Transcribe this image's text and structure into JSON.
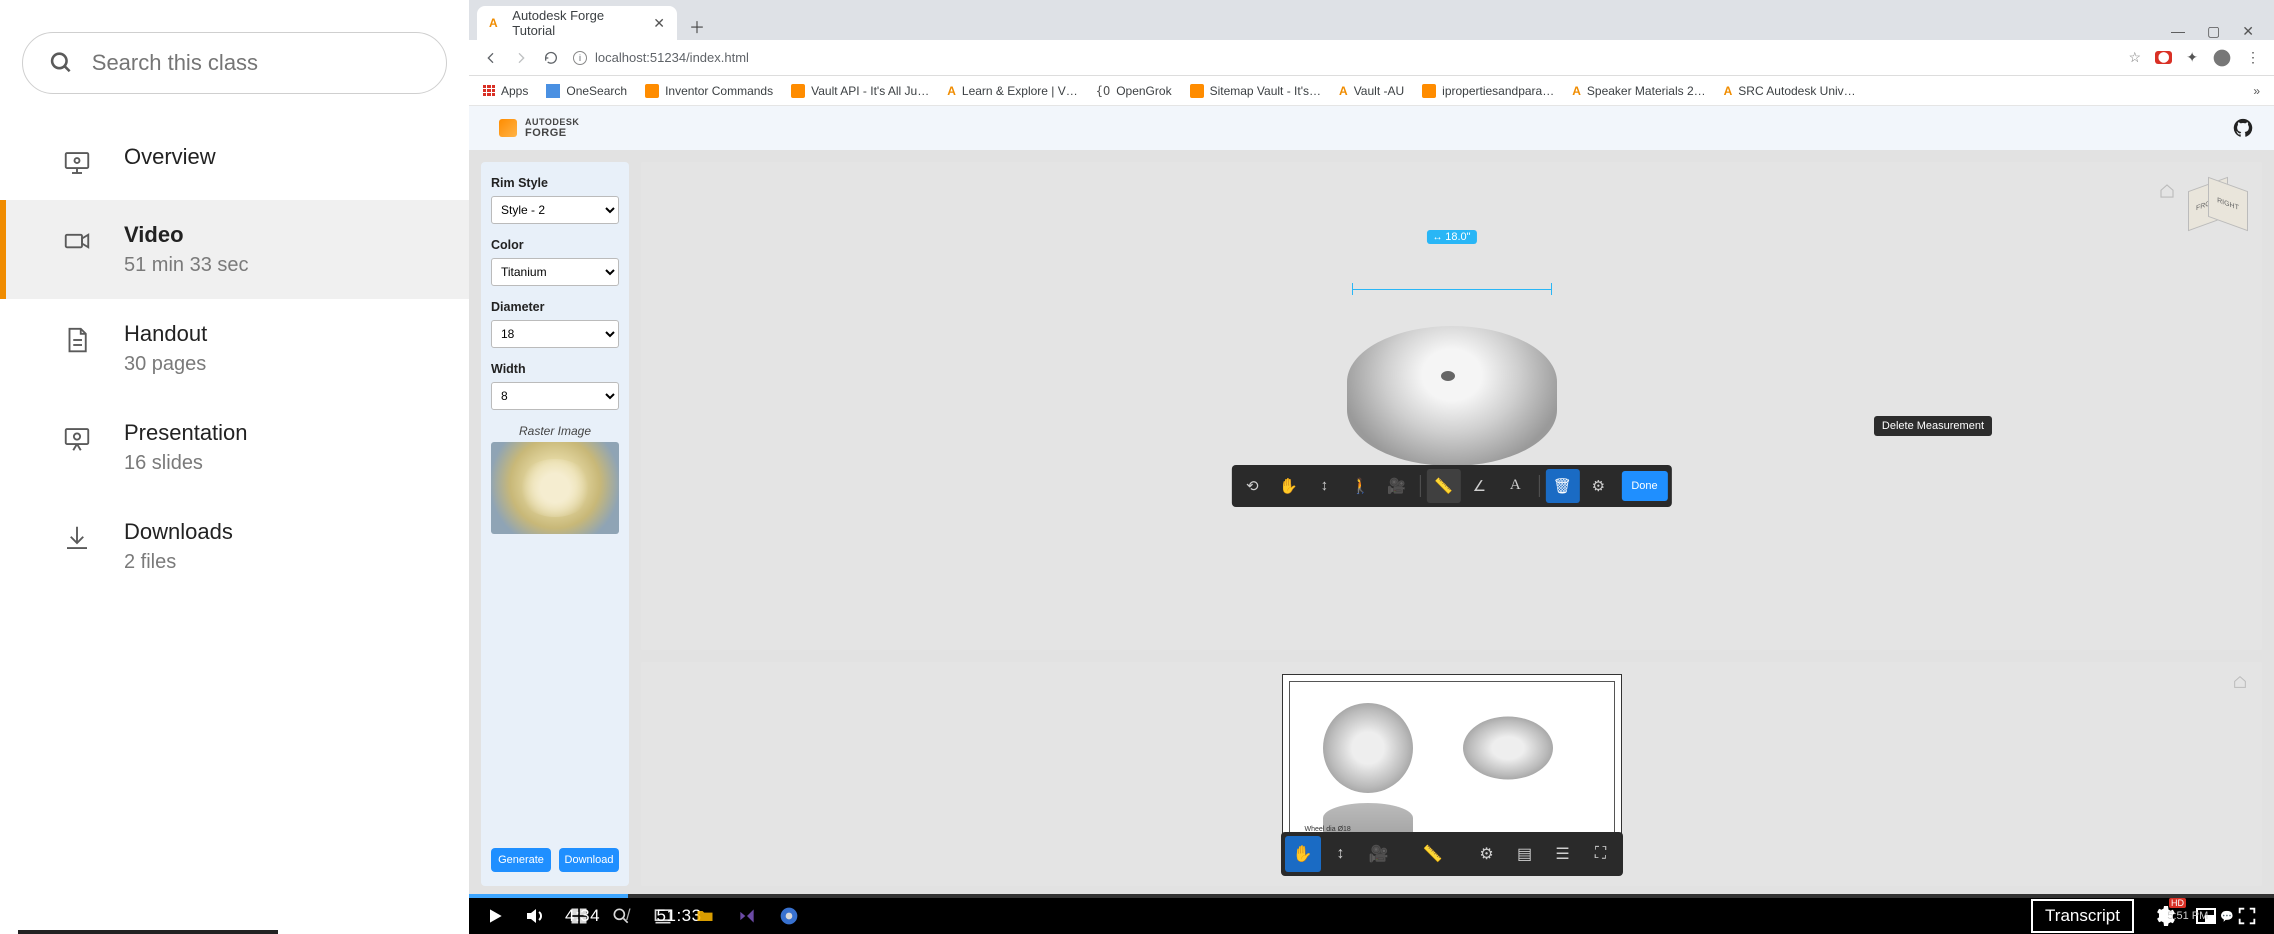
{
  "sidebar": {
    "search_placeholder": "Search this class",
    "items": [
      {
        "title": "Overview",
        "sub": ""
      },
      {
        "title": "Video",
        "sub": "51 min 33 sec"
      },
      {
        "title": "Handout",
        "sub": "30 pages"
      },
      {
        "title": "Presentation",
        "sub": "16 slides"
      },
      {
        "title": "Downloads",
        "sub": "2 files"
      }
    ]
  },
  "browser": {
    "tab_title": "Autodesk Forge Tutorial",
    "url": "localhost:51234/index.html",
    "bookmarks": [
      "Apps",
      "OneSearch",
      "Inventor Commands",
      "Vault API - It's All Ju…",
      "Learn & Explore | V…",
      "OpenGrok",
      "Sitemap Vault - It's…",
      "Vault -AU",
      "ipropertiesandpara…",
      "Speaker Materials 2…",
      "SRC Autodesk Univ…"
    ]
  },
  "forge": {
    "brand_top": "AUTODESK",
    "brand_bottom": "FORGE",
    "panel": {
      "rim_style_label": "Rim Style",
      "rim_style_value": "Style - 2",
      "color_label": "Color",
      "color_value": "Titanium",
      "diameter_label": "Diameter",
      "diameter_value": "18",
      "width_label": "Width",
      "width_value": "8",
      "raster_label": "Raster Image",
      "generate": "Generate",
      "download": "Download"
    },
    "measurement": "18.0\"",
    "tooltip": "Delete Measurement",
    "done": "Done",
    "drawing_label": "Wheel dia Ø18",
    "viewcube_front": "FRONT",
    "viewcube_right": "RIGHT"
  },
  "player": {
    "current": "4:34",
    "total": "51:33",
    "transcript": "Transcript",
    "hd": "HD",
    "clock": "5:51 PM"
  }
}
